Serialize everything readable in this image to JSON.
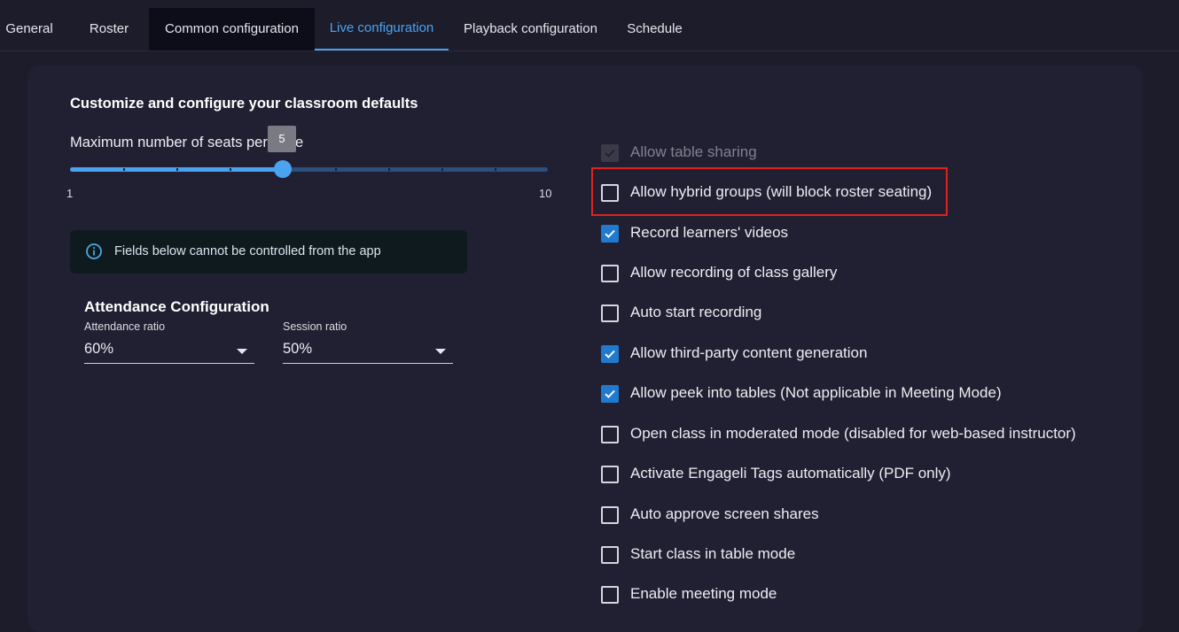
{
  "tabs": [
    {
      "label": "General"
    },
    {
      "label": "Roster"
    },
    {
      "label": "Common configuration"
    },
    {
      "label": "Live configuration"
    },
    {
      "label": "Playback configuration"
    },
    {
      "label": "Schedule"
    }
  ],
  "active_tab": "Live configuration",
  "section_title": "Customize and configure your classroom defaults",
  "seats_slider": {
    "label": "Maximum number of seats per table",
    "value": "5",
    "min": "1",
    "max": "10"
  },
  "info_box": {
    "icon": "info-circle-icon",
    "text": "Fields below cannot be controlled from the app"
  },
  "attendance": {
    "title": "Attendance Configuration",
    "attendance_ratio": {
      "label": "Attendance ratio",
      "value": "60%"
    },
    "session_ratio": {
      "label": "Session ratio",
      "value": "50%"
    }
  },
  "options": [
    {
      "label": "Allow table sharing",
      "checked": true,
      "disabled": true
    },
    {
      "label": "Allow hybrid groups (will block roster seating)",
      "checked": false,
      "highlighted": true
    },
    {
      "label": "Record learners' videos",
      "checked": true
    },
    {
      "label": "Allow recording of class gallery",
      "checked": false
    },
    {
      "label": "Auto start recording",
      "checked": false
    },
    {
      "label": "Allow third-party content generation",
      "checked": true
    },
    {
      "label": "Allow peek into tables (Not applicable in Meeting Mode)",
      "checked": true
    },
    {
      "label": "Open class in moderated mode (disabled for web-based instructor)",
      "checked": false
    },
    {
      "label": "Activate Engageli Tags automatically (PDF only)",
      "checked": false
    },
    {
      "label": "Auto approve screen shares",
      "checked": false
    },
    {
      "label": "Start class in table mode",
      "checked": false
    },
    {
      "label": "Enable meeting mode",
      "checked": false
    }
  ],
  "colors": {
    "accent": "#4aa3f0",
    "checkbox_checked": "#1f7ad0",
    "highlight_box": "#e0211e",
    "background": "#1c1c2b",
    "card": "#202032"
  }
}
